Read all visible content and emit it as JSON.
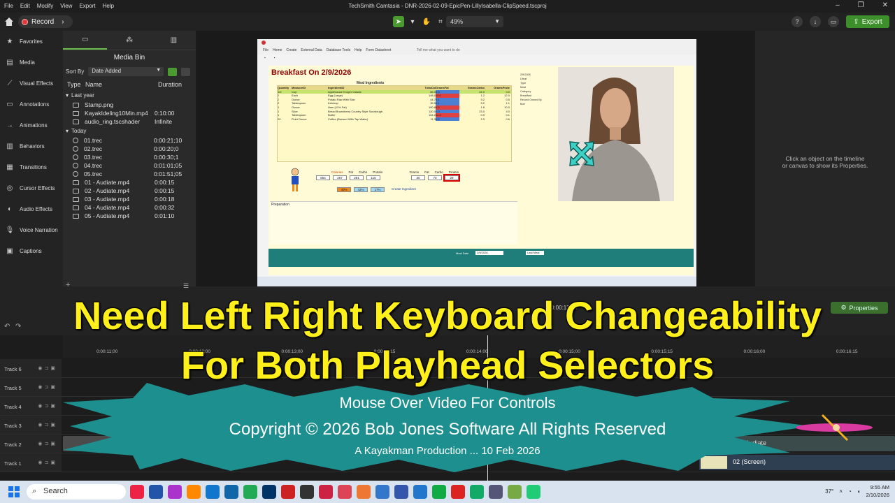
{
  "window": {
    "title": "TechSmith Camtasia - DNR-2026-02-09-EpicPen-LillyIsabella-ClipSpeed.tscproj",
    "menus": [
      "File",
      "Edit",
      "Modify",
      "View",
      "Export",
      "Help"
    ]
  },
  "toolbar": {
    "record_label": "Record",
    "zoom_value": "49%",
    "export_label": "Export"
  },
  "sidebar": {
    "items": [
      {
        "label": "Favorites",
        "icon": "star-icon"
      },
      {
        "label": "Media",
        "icon": "film-icon"
      },
      {
        "label": "Visual Effects",
        "icon": "wand-icon"
      },
      {
        "label": "Annotations",
        "icon": "annotation-icon"
      },
      {
        "label": "Animations",
        "icon": "arrows-icon"
      },
      {
        "label": "Behaviors",
        "icon": "bars-icon"
      },
      {
        "label": "Transitions",
        "icon": "transition-icon"
      },
      {
        "label": "Cursor Effects",
        "icon": "cursor-icon"
      },
      {
        "label": "Audio Effects",
        "icon": "audio-icon"
      },
      {
        "label": "Voice Narration",
        "icon": "mic-icon"
      },
      {
        "label": "Captions",
        "icon": "cc-icon"
      }
    ]
  },
  "bin": {
    "title": "Media Bin",
    "sort_label": "Sort By",
    "sort_value": "Date Added",
    "col_type": "Type",
    "col_name": "Name",
    "col_duration": "Duration",
    "group1": "Last year",
    "group2": "Today",
    "last_year": [
      {
        "name": "Stamp.png",
        "dur": ""
      },
      {
        "name": "KayakIdeling10Min.mp4",
        "dur": "0:10:00"
      },
      {
        "name": "audio_ring.tscshader",
        "dur": "Infinite"
      }
    ],
    "today": [
      {
        "name": "01.trec",
        "dur": "0:00:21;10"
      },
      {
        "name": "02.trec",
        "dur": "0:00:20;0"
      },
      {
        "name": "03.trec",
        "dur": "0:00:30;1"
      },
      {
        "name": "04.trec",
        "dur": "0:01:01;05"
      },
      {
        "name": "05.trec",
        "dur": "0:01:51;05"
      },
      {
        "name": "01 - Audiate.mp4",
        "dur": "0:00:15"
      },
      {
        "name": "02 - Audiate.mp4",
        "dur": "0:00:15"
      },
      {
        "name": "03 - Audiate.mp4",
        "dur": "0:00:18"
      },
      {
        "name": "04 - Audiate.mp4",
        "dur": "0:00:32"
      },
      {
        "name": "05 - Audiate.mp4",
        "dur": "0:01:10"
      }
    ]
  },
  "properties": {
    "hint_line1": "Click an object on the timeline",
    "hint_line2": "or canvas to show its Properties.",
    "button": "Properties"
  },
  "canvas": {
    "app_menu": [
      "File",
      "Home",
      "Create",
      "External Data",
      "Database Tools",
      "Help",
      "Form Datasheet"
    ],
    "tell_me": "Tell me what you want to do",
    "form_title": "Breakfast On 2/9/2026",
    "section_title": "Meal Ingredients",
    "headers": [
      "Quantity",
      "MeasureID",
      "IngredientID",
      "TotalCal",
      "GramsFat",
      "GramsCarbo",
      "GramsProte"
    ],
    "rows": [
      [
        "1/2",
        "Cup",
        "Applesauce Kroger Classic",
        "86.0",
        "0.0",
        "24.0",
        "0.0"
      ],
      [
        "2",
        "Each",
        "Egg (Large)",
        "148.0",
        "10.0",
        "1.2",
        "12.0"
      ],
      [
        "2",
        "Ounce",
        "Potato Raw With Skin",
        "44.7",
        "0.1",
        "9.2",
        "0.5"
      ],
      [
        "2",
        "Tablespoon",
        "Ketchup",
        "35.5",
        "0.1",
        "9.2",
        "1.1"
      ],
      [
        "1",
        "Ounce",
        "Ham (11% Fat)",
        "100.8",
        "6.3",
        "1.8",
        "10.0"
      ],
      [
        "1",
        "Slice",
        "Bread Brownberry Country Style Sourdough",
        "120.0",
        "2.0",
        "23.0",
        "4.0"
      ],
      [
        "1",
        "Tablespoon",
        "Butter",
        "104.2",
        "11.3",
        "0.0",
        "0.1"
      ],
      [
        "20",
        "Fluid Ounce",
        "Coffee (Brewed With Tap Water)",
        "11.3",
        "0.2",
        "2.3",
        "0.6"
      ]
    ],
    "totals_labels": [
      "Calories",
      "Fat",
      "Carbo",
      "Protein"
    ],
    "totals_values": [
      "664",
      "267",
      "281",
      "115"
    ],
    "grams_labels": [
      "Grams",
      "Fat",
      "Carbo",
      "Protein"
    ],
    "grams_values": [
      "30",
      "70",
      "29"
    ],
    "percent_values": [
      "40%",
      "42%",
      "17%"
    ],
    "create_ingredient": "Create Ingredient",
    "preparation": "Preparation",
    "side_date": "2/9/2026",
    "side_labels": [
      "Lifeat",
      "Type",
      "Meal",
      "Category",
      "Breakfast",
      "Record Owned By",
      "Bob"
    ],
    "last_meal": "Last Meal",
    "recipe_date_label": "Meal Date",
    "recipe_date_value": "2/9/2026"
  },
  "timeline": {
    "time_display": "0:00:13;24",
    "ticks": [
      "0:00:11;00",
      "0:00:12;00",
      "0:00:13;00",
      "0:00:13;15",
      "0:00:14;00",
      "0:00:15;00",
      "0:00:15;15",
      "0:00:16;00",
      "0:00:16;15"
    ],
    "tracks": [
      "Track 6",
      "Track 5",
      "Track 4",
      "Track 3",
      "Track 2",
      "Track 1"
    ],
    "clip_audiate": "02 - Audiate",
    "clip_screen": "02 (Screen)"
  },
  "overlay": {
    "line1": "Need Left Right Keyboard Changeability",
    "line2": "For Both Playhead Selectors",
    "burst1": "Mouse Over Video For Controls",
    "burst2": "Copyright © 2026 Bob Jones Software All Rights Reserved",
    "burst3": "A Kayakman Production ... 10 Feb 2026"
  },
  "taskbar": {
    "search": "Search",
    "weather": "37°",
    "time": "9:55 AM",
    "date": "2/10/2026"
  },
  "colors": {
    "accent": "#4a9a2f",
    "overlay_text": "#ffef1a",
    "burst": "#1e8f8f"
  }
}
